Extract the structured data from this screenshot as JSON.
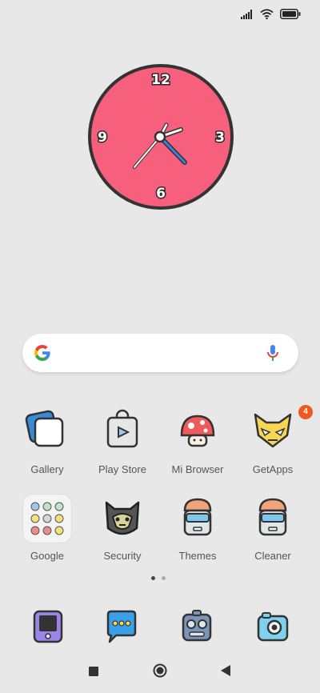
{
  "status_bar": {
    "icons": [
      "signal-icon",
      "wifi-icon",
      "battery-icon"
    ]
  },
  "clock": {
    "numerals": [
      "12",
      "3",
      "6",
      "9"
    ],
    "face_color": "#f7607d",
    "minute_hand_color": "#3d7fd9"
  },
  "search": {
    "logo": "G",
    "icons": [
      "google-g-icon",
      "mic-icon"
    ]
  },
  "apps": [
    {
      "label": "Gallery",
      "icon": "gallery-icon"
    },
    {
      "label": "Play Store",
      "icon": "play-store-icon"
    },
    {
      "label": "Mi Browser",
      "icon": "mushroom-browser-icon"
    },
    {
      "label": "GetApps",
      "icon": "getapps-mask-icon",
      "badge": "4"
    },
    {
      "label": "Google",
      "icon": "google-folder-icon"
    },
    {
      "label": "Security",
      "icon": "security-cat-icon"
    },
    {
      "label": "Themes",
      "icon": "themes-robot-icon"
    },
    {
      "label": "Cleaner",
      "icon": "cleaner-robot-icon"
    }
  ],
  "page_indicator": {
    "pages": 2,
    "current": 1
  },
  "dock": [
    {
      "icon": "phone-icon"
    },
    {
      "icon": "messages-icon"
    },
    {
      "icon": "robot-camera-icon"
    },
    {
      "icon": "camera-icon"
    }
  ],
  "nav": [
    {
      "icon": "recents-icon"
    },
    {
      "icon": "home-icon"
    },
    {
      "icon": "back-icon"
    }
  ]
}
